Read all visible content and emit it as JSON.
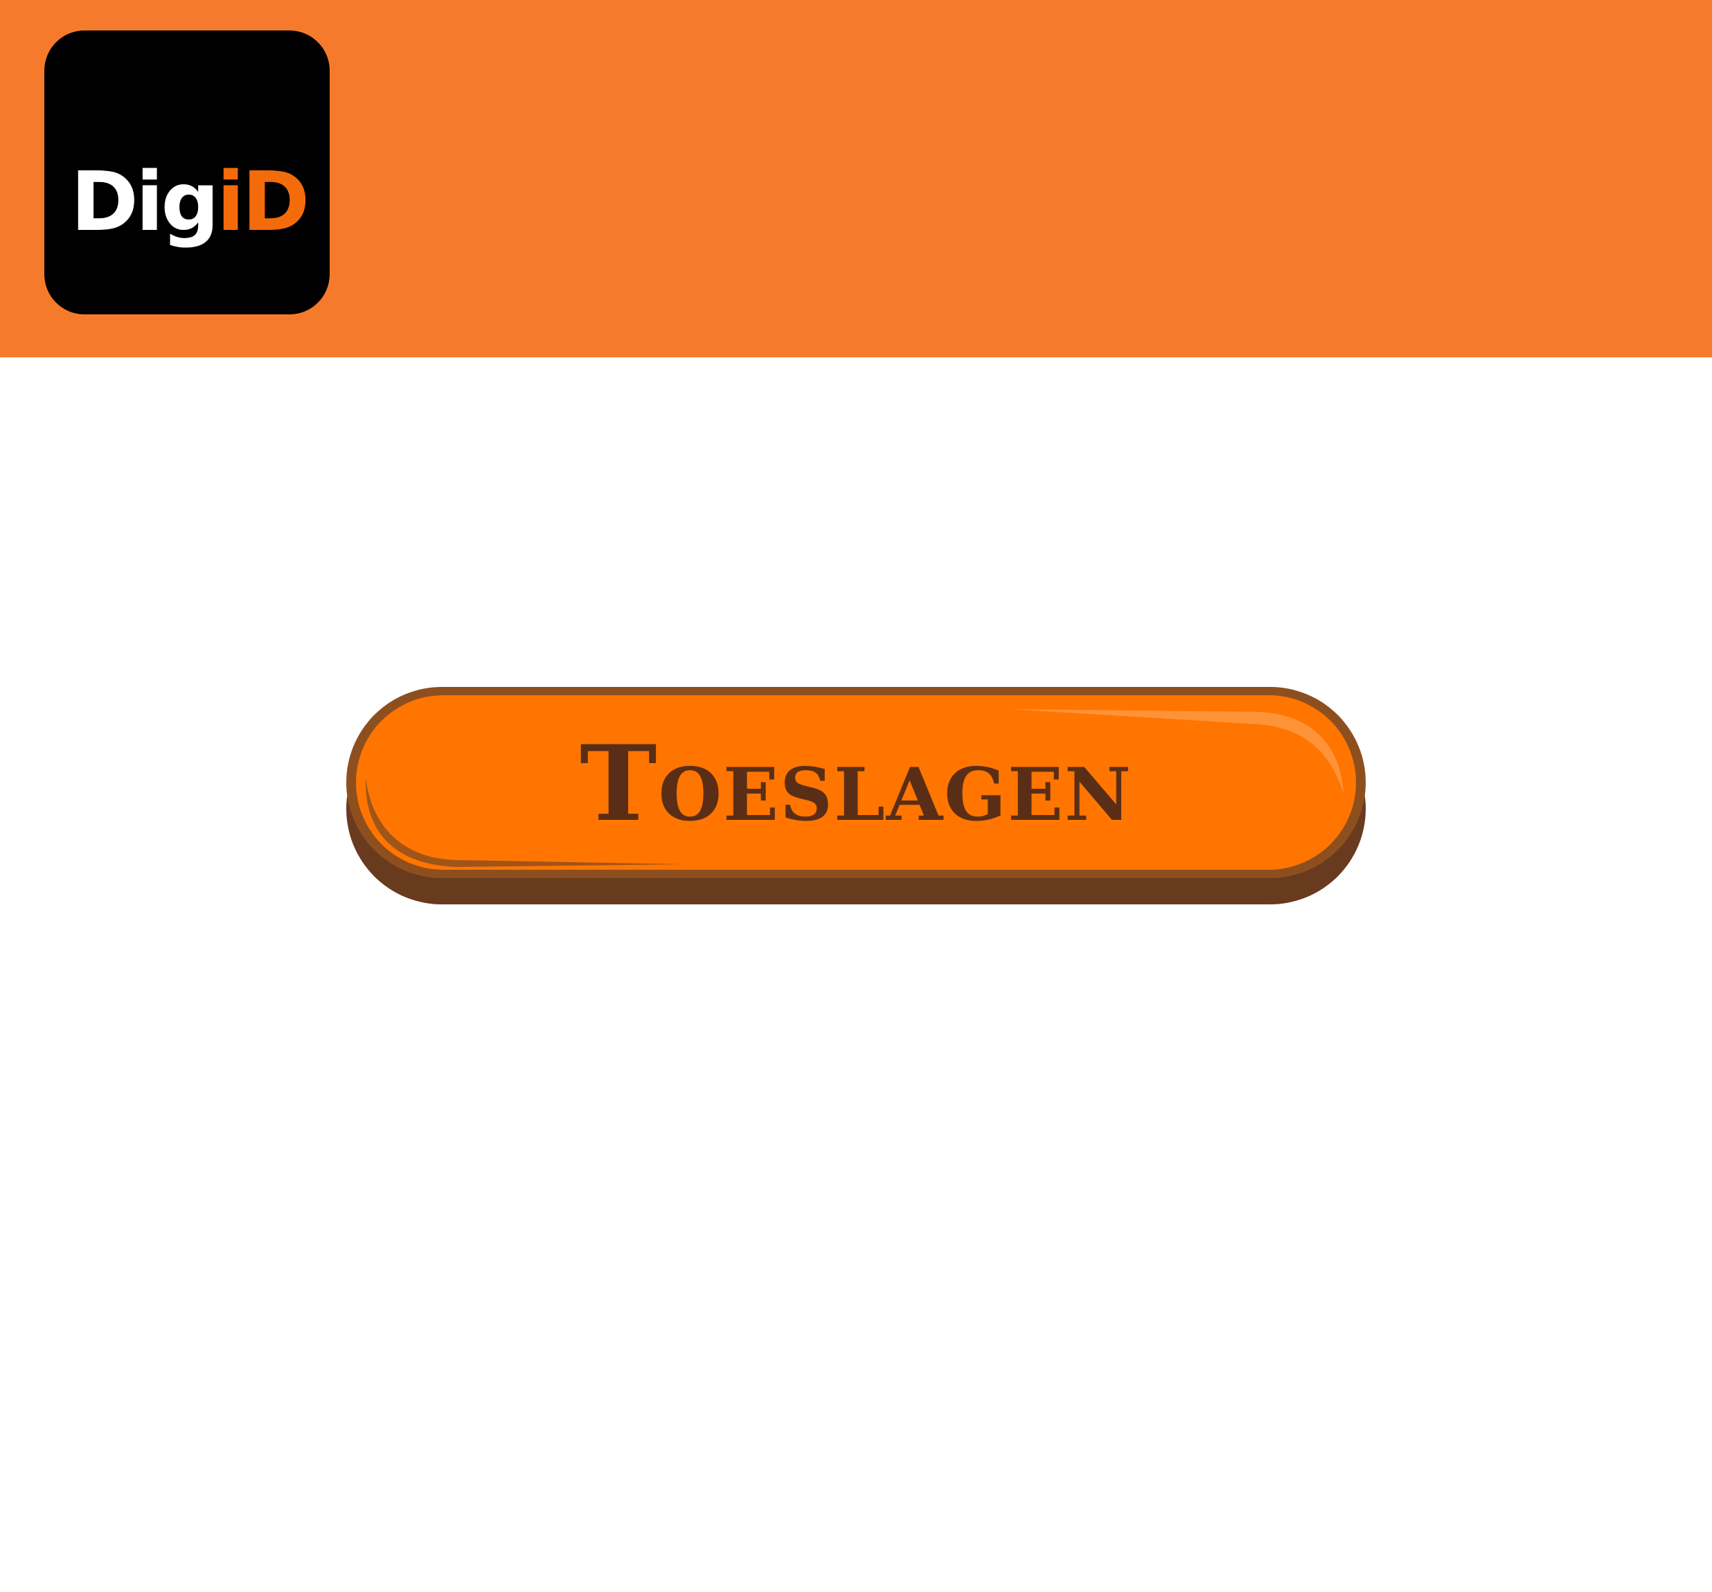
{
  "header": {
    "logo": {
      "text_primary": "Dig",
      "text_accent": "iD"
    }
  },
  "main": {
    "button_label": "Toeslagen"
  },
  "colors": {
    "header_bg": "#f67a2c",
    "logo_bg": "#000000",
    "logo_accent": "#f46b0b",
    "button_fill": "#ff7500",
    "button_border": "#8e4f1f",
    "button_shadow": "#683a1e",
    "button_text": "#5a2e16"
  }
}
